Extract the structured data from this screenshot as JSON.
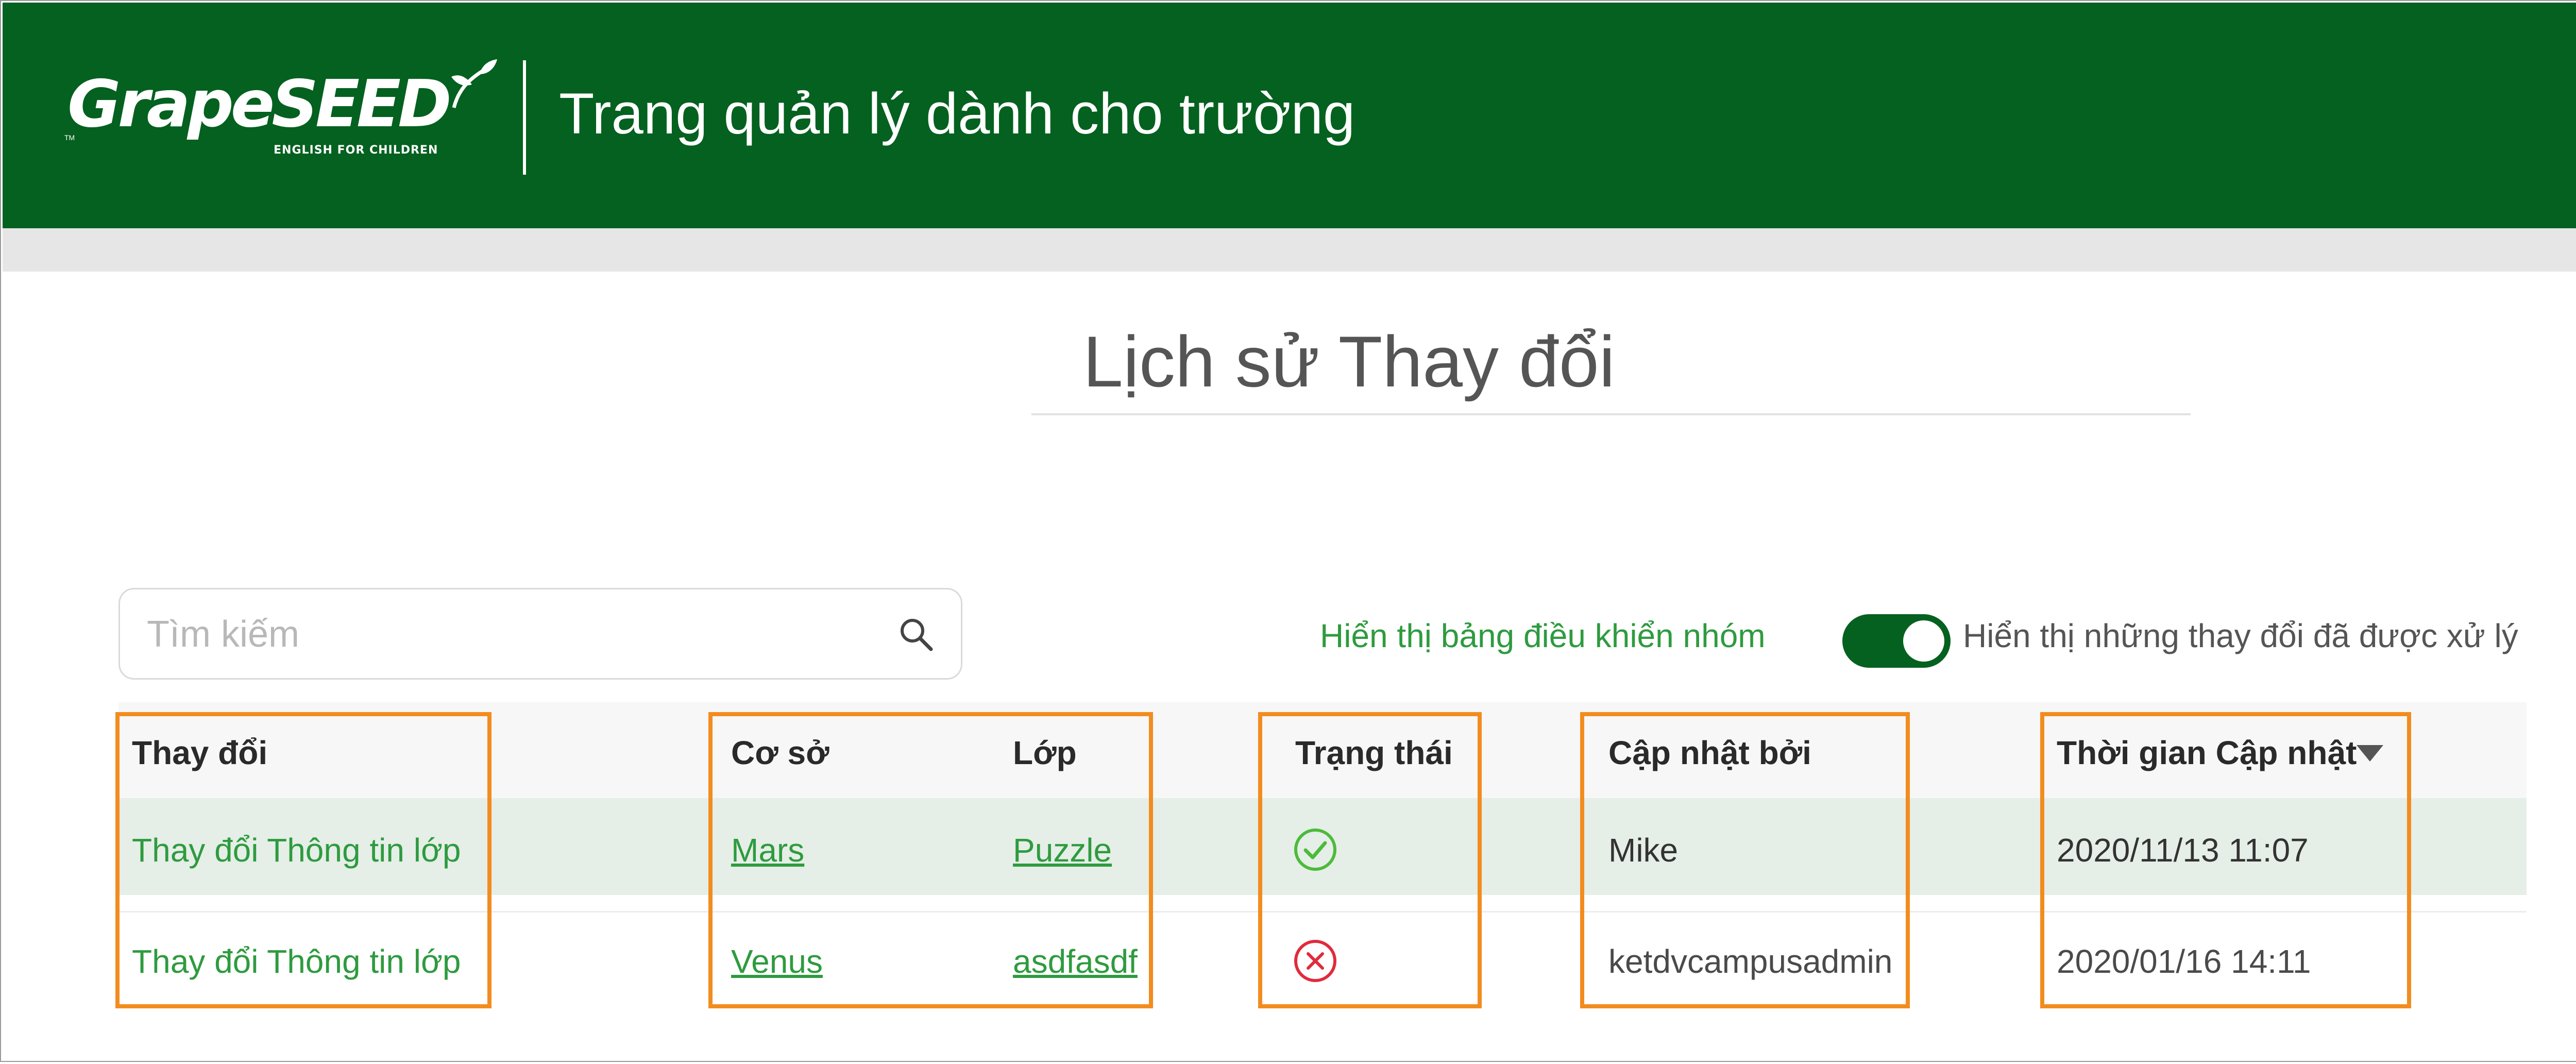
{
  "header": {
    "logo_text": "GrapeSEED",
    "logo_tagline": "ENGLISH FOR CHILDREN",
    "logo_tm": "TM",
    "app_title": "Trang quản lý dành cho trường"
  },
  "page": {
    "title": "Lịch sử Thay đổi"
  },
  "toolbar": {
    "search_placeholder": "Tìm kiếm",
    "group_dashboard_link": "Hiển thị bảng điều khiển nhóm",
    "show_processed_label": "Hiển thị những thay đổi đã được xử lý",
    "show_processed_on": true
  },
  "table": {
    "columns": {
      "change": "Thay đổi",
      "campus": "Cơ sở",
      "class": "Lớp",
      "status": "Trạng thái",
      "updated_by": "Cập nhật bởi",
      "updated_time": "Thời gian Cập nhật"
    },
    "sort": {
      "column": "updated_time",
      "direction": "desc"
    },
    "rows": [
      {
        "change": "Thay đổi Thông tin lớp",
        "campus": "Mars",
        "class": "Puzzle",
        "status": "approved",
        "updated_by": "Mike",
        "updated_time": "2020/11/13 11:07"
      },
      {
        "change": "Thay đổi Thông tin lớp",
        "campus": "Venus",
        "class": "asdfasdf",
        "status": "rejected",
        "updated_by": "ketdvcampusadmin",
        "updated_time": "2020/01/16 14:11"
      }
    ]
  },
  "colors": {
    "brand_green": "#04611f",
    "link_green": "#2e9b3f",
    "highlight_orange": "#f28c1f",
    "approved_icon": "#4cbb3a",
    "rejected_icon": "#e02b3c"
  },
  "icons": {
    "search": "search-icon",
    "sort": "sort-desc-icon",
    "approved": "check-circle-icon",
    "rejected": "x-circle-icon"
  }
}
